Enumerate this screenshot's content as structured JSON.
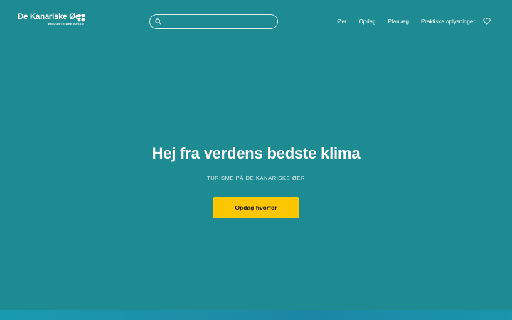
{
  "header": {
    "logo": {
      "name": "De Kanariske Øer",
      "tagline": "EN UGIFTE ØREØGGAN"
    },
    "search": {
      "value": "",
      "placeholder": ""
    },
    "nav": [
      {
        "label": "Øer"
      },
      {
        "label": "Opdag"
      },
      {
        "label": "Planlæg"
      },
      {
        "label": "Praktiske oplysninger"
      }
    ],
    "favorites_icon": "heart-icon"
  },
  "hero": {
    "title": "Hej fra verdens bedste klima",
    "subtitle": "TURISME PÅ DE KANARISKE ØER",
    "cta_label": "Opdag hvorfor"
  },
  "colors": {
    "background": "#1e8a91",
    "cta": "#fcc600",
    "text": "#ffffff"
  }
}
